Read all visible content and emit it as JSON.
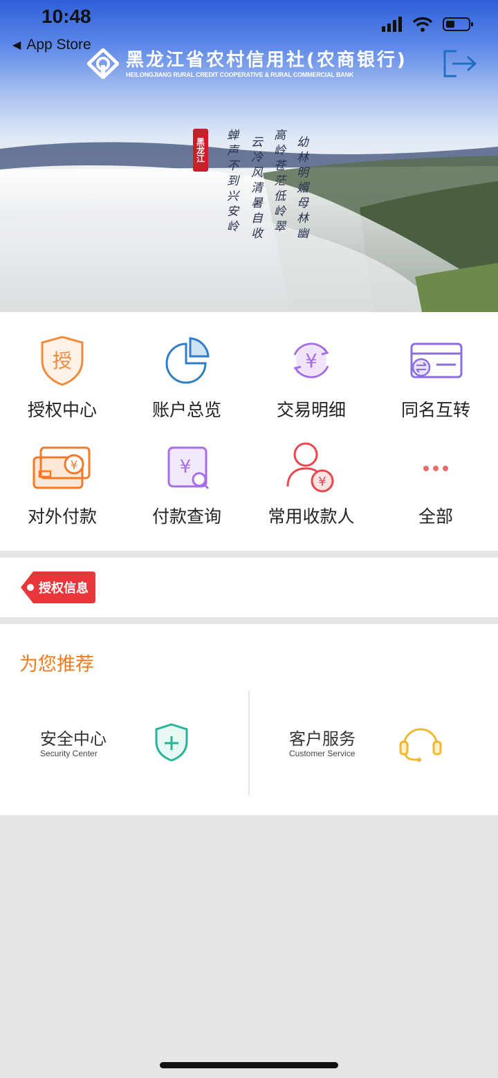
{
  "status_bar": {
    "time": "10:48",
    "back_label": "App Store"
  },
  "header": {
    "bank_name_cn": "黑龙江省农村信用社(农商银行)",
    "bank_name_en": "HEILONGJIANG RURAL CREDIT COOPERATIVE & RURAL COMMERCIAL BANK",
    "logout_icon": "logout-icon"
  },
  "banner": {
    "seal_text": "黑龙江",
    "poem_columns": [
      "蝉声不到兴安岭",
      "云冷风清暑自收",
      "高岭苍茫低岭翠",
      "幼林明媚母林幽"
    ]
  },
  "grid": {
    "items": [
      {
        "label": "授权中心",
        "icon": "authorize-shield-icon",
        "color": "#f28a3a"
      },
      {
        "label": "账户总览",
        "icon": "pie-chart-icon",
        "color": "#2f7dc6"
      },
      {
        "label": "交易明细",
        "icon": "yuan-cycle-icon",
        "color": "#a66de8"
      },
      {
        "label": "同名互转",
        "icon": "card-transfer-icon",
        "color": "#8a6ee0"
      },
      {
        "label": "对外付款",
        "icon": "payment-card-icon",
        "color": "#f07a2a"
      },
      {
        "label": "付款查询",
        "icon": "payment-search-icon",
        "color": "#a66de8"
      },
      {
        "label": "常用收款人",
        "icon": "payee-icon",
        "color": "#e8484d"
      },
      {
        "label": "全部",
        "icon": "more-dots-icon",
        "color": "#f06a6a"
      }
    ],
    "authorize_glyph": "授"
  },
  "auth_info": {
    "tag_label": "授权信息"
  },
  "recommend": {
    "title": "为您推荐",
    "cards": [
      {
        "title_cn": "安全中心",
        "title_en": "Security Center",
        "icon": "security-shield-icon",
        "color": "#2bb39a"
      },
      {
        "title_cn": "客户服务",
        "title_en": "Customer Service",
        "icon": "headset-icon",
        "color": "#f2b630"
      }
    ]
  },
  "colors": {
    "accent_orange": "#f07a1a",
    "tag_red": "#e8363a"
  }
}
